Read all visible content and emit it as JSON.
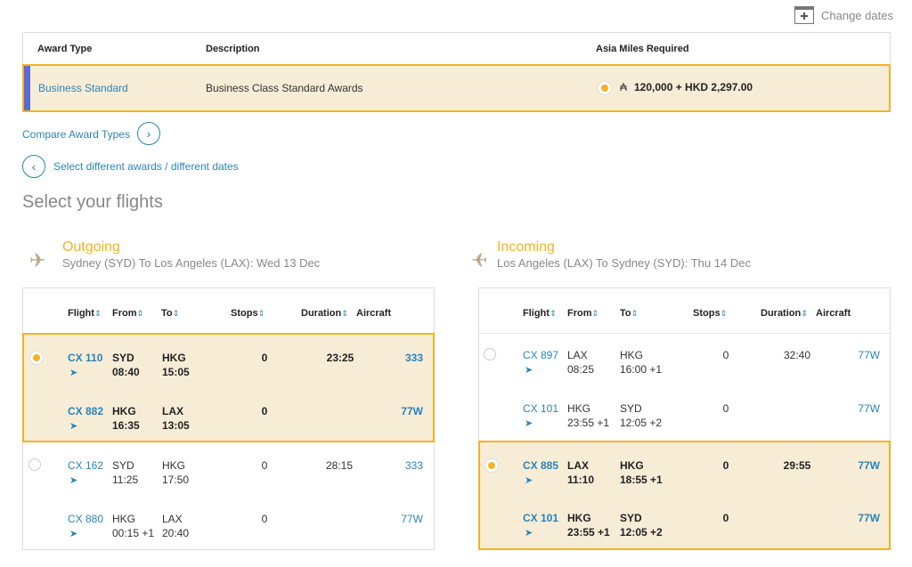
{
  "header": {
    "change_dates": "Change dates"
  },
  "award_table": {
    "headers": {
      "award_type": "Award Type",
      "description": "Description",
      "miles_required": "Asia Miles Required"
    },
    "row": {
      "award_type": "Business Standard",
      "description": "Business Class Standard Awards",
      "miles_symbol": "₳",
      "miles": "120,000 + HKD 2,297.00",
      "selected": true
    }
  },
  "links": {
    "compare": "Compare Award Types",
    "select_different": "Select different awards / different dates"
  },
  "page_title": "Select your flights",
  "columns": {
    "flight": "Flight",
    "from": "From",
    "to": "To",
    "stops": "Stops",
    "duration": "Duration",
    "aircraft": "Aircraft",
    "sort_icon": "⇕"
  },
  "outgoing": {
    "label": "Outgoing",
    "route": "Sydney (SYD) To Los Angeles (LAX): Wed 13 Dec",
    "options": [
      {
        "selected": true,
        "duration": "23:25",
        "legs": [
          {
            "flight": "CX 110",
            "from": "SYD",
            "dep": "08:40",
            "to": "HKG",
            "arr": "15:05",
            "stops": "0",
            "aircraft": "333"
          },
          {
            "flight": "CX 882",
            "from": "HKG",
            "dep": "16:35",
            "to": "LAX",
            "arr": "13:05",
            "stops": "0",
            "aircraft": "77W"
          }
        ]
      },
      {
        "selected": false,
        "duration": "28:15",
        "legs": [
          {
            "flight": "CX 162",
            "from": "SYD",
            "dep": "11:25",
            "to": "HKG",
            "arr": "17:50",
            "stops": "0",
            "aircraft": "333"
          },
          {
            "flight": "CX 880",
            "from": "HKG",
            "dep": "00:15 +1",
            "to": "LAX",
            "arr": "20:40",
            "stops": "0",
            "aircraft": "77W"
          }
        ]
      }
    ]
  },
  "incoming": {
    "label": "Incoming",
    "route": "Los Angeles (LAX) To Sydney (SYD): Thu 14 Dec",
    "options": [
      {
        "selected": false,
        "duration": "32:40",
        "legs": [
          {
            "flight": "CX 897",
            "from": "LAX",
            "dep": "08:25",
            "to": "HKG",
            "arr": "16:00 +1",
            "stops": "0",
            "aircraft": "77W"
          },
          {
            "flight": "CX 101",
            "from": "HKG",
            "dep": "23:55 +1",
            "to": "SYD",
            "arr": "12:05 +2",
            "stops": "0",
            "aircraft": "77W"
          }
        ]
      },
      {
        "selected": true,
        "duration": "29:55",
        "legs": [
          {
            "flight": "CX 885",
            "from": "LAX",
            "dep": "11:10",
            "to": "HKG",
            "arr": "18:55 +1",
            "stops": "0",
            "aircraft": "77W"
          },
          {
            "flight": "CX 101",
            "from": "HKG",
            "dep": "23:55 +1",
            "to": "SYD",
            "arr": "12:05 +2",
            "stops": "0",
            "aircraft": "77W"
          }
        ]
      }
    ]
  },
  "colors": {
    "accent": "#f4b322",
    "link": "#2a84b9",
    "selected_bg": "#f7ecd6",
    "award_bar": "#5b6cd3"
  }
}
